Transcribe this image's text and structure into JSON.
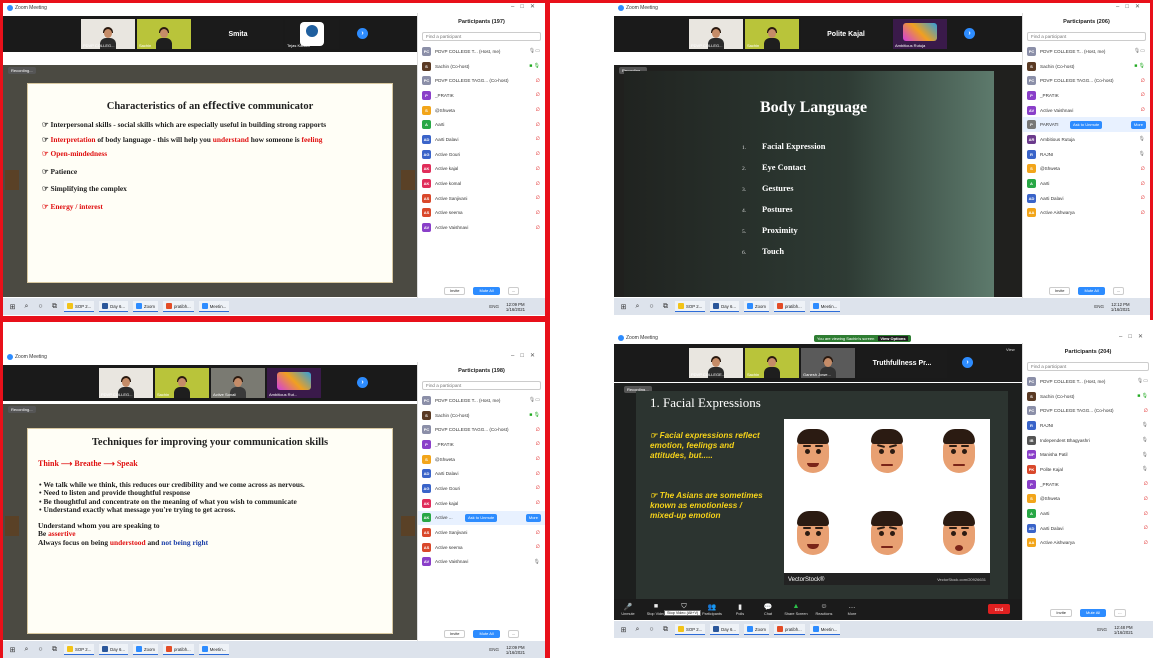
{
  "q1": {
    "window_title": "Zoom Meeting",
    "tiles": [
      "PDVP COLLEG...",
      "Sachin",
      "Smita",
      "Tejas Kadam"
    ],
    "recording": "Recording...",
    "slide_title_pre": "Characteristics of an ",
    "slide_title_emph": "effective",
    "slide_title_post": " communicator",
    "b1": "Interpersonal skills - social skills which are especially useful in building strong rapports",
    "b2_a": "Interpretation",
    "b2_b": " of body language - this will help you ",
    "b2_c": "understand",
    "b2_d": " how someone is ",
    "b2_e": "feeling",
    "b3": "Open-mindedness",
    "b4": "Patience",
    "b5": "Simplifying the complex",
    "b6": "Energy / interest",
    "participants_title": "Participants (197)",
    "find": "Find a participant",
    "rows": [
      {
        "init": "PC",
        "color": "#8b8fa8",
        "name": "PDVP COLLEGE T... (Host, me)"
      },
      {
        "init": "S",
        "color": "#5a3a24",
        "name": "Sachin (Co-host)"
      },
      {
        "init": "PC",
        "color": "#8b8fa8",
        "name": "PDVP COLLEGE TAGG... (Co-host)"
      },
      {
        "init": "P",
        "color": "#8a3fc9",
        "name": "_PRATIK"
      },
      {
        "init": "S",
        "color": "#f2a51a",
        "name": "@Shweta"
      },
      {
        "init": "A",
        "color": "#28a745",
        "name": "Aarti"
      },
      {
        "init": "AD",
        "color": "#3a64c9",
        "name": "Aarti Dalavi"
      },
      {
        "init": "AG",
        "color": "#3a64c9",
        "name": "Active Gouri"
      },
      {
        "init": "AK",
        "color": "#e02d5a",
        "name": "Active kajal"
      },
      {
        "init": "AK",
        "color": "#e02d5a",
        "name": "Active komal"
      },
      {
        "init": "AS",
        "color": "#d9482b",
        "name": "Active Sanjivani"
      },
      {
        "init": "AS",
        "color": "#d9482b",
        "name": "Active seema"
      },
      {
        "init": "AV",
        "color": "#8a3fc9",
        "name": "Active Vaishnavi"
      }
    ],
    "invite": "Invite",
    "mute_all": "Mute All",
    "more_btn": "...",
    "clock_time": "12:09 PM",
    "clock_date": "1/16/2021"
  },
  "q2": {
    "window_title": "Zoom Meeting",
    "tiles": [
      "PDVP COLLEG...",
      "Sachin",
      "Polite Kajal",
      "Ambitious Rutuja"
    ],
    "recording": "Recording...",
    "slide_title": "Body Language",
    "list": [
      {
        "n": "1.",
        "t": "Facial Expression"
      },
      {
        "n": "2.",
        "t": "Eye Contact"
      },
      {
        "n": "3.",
        "t": "Gestures"
      },
      {
        "n": "4.",
        "t": "Postures"
      },
      {
        "n": "5.",
        "t": "Proximity"
      },
      {
        "n": "6.",
        "t": "Touch"
      }
    ],
    "participants_title": "Participants (206)",
    "find": "Find a participant",
    "rows": [
      {
        "init": "PC",
        "color": "#8b8fa8",
        "name": "PDVP COLLEGE T... (Host, me)"
      },
      {
        "init": "S",
        "color": "#5a3a24",
        "name": "Sachin (Co-host)"
      },
      {
        "init": "PC",
        "color": "#8b8fa8",
        "name": "PDVP COLLEGE TAGG... (Co-host)"
      },
      {
        "init": "P",
        "color": "#8a3fc9",
        "name": "_PRATIK"
      },
      {
        "init": "AV",
        "color": "#8a3fc9",
        "name": "Active Vaishnavi"
      },
      {
        "init": "P",
        "color": "#777",
        "name": "PARVATI"
      },
      {
        "init": "AR",
        "color": "#6b3a8c",
        "name": "Ambitious Rutuja"
      },
      {
        "init": "R",
        "color": "#3a64c9",
        "name": "RAJNI"
      },
      {
        "init": "S",
        "color": "#f2a51a",
        "name": "@Shweta"
      },
      {
        "init": "A",
        "color": "#28a745",
        "name": "Aarti"
      },
      {
        "init": "AD",
        "color": "#3a64c9",
        "name": "Aarti Dalavi"
      },
      {
        "init": "AA",
        "color": "#f2a51a",
        "name": "Active Aishwarya"
      }
    ],
    "unmute": "Ask to Unmute",
    "more": "More",
    "invite": "Invite",
    "mute_all": "Mute All",
    "more_btn": "...",
    "clock_time": "12:12 PM",
    "clock_date": "1/16/2021"
  },
  "q3": {
    "window_title": "Zoom Meeting",
    "tiles": [
      "PDVP COLLEG...",
      "Sachin",
      "Active Sonali",
      "Ambitious Rut..."
    ],
    "recording": "Recording...",
    "slide_title": "Techniques for improving your communication skills",
    "think": "Think",
    "breathe": "Breathe",
    "speak": "Speak",
    "b1": "We talk while we think, this reduces our credibility and we come across as nervous.",
    "b2": "Need to listen and provide thoughtful response",
    "b3": "Be thoughtful and concentrate on the meaning of what you wish to communicate",
    "b4": "Understand exactly what message you're trying to get across.",
    "p1": "Understand whom you are speaking to",
    "p2_a": "Be ",
    "p2_b": "assertive",
    "p3_a": "Always focus on being ",
    "p3_b": "understood",
    "p3_c": " and ",
    "p3_d": "not being right",
    "participants_title": "Participants (198)",
    "find": "Find a participant",
    "rows": [
      {
        "init": "PC",
        "color": "#8b8fa8",
        "name": "PDVP COLLEGE T... (Host, me)"
      },
      {
        "init": "S",
        "color": "#5a3a24",
        "name": "Sachin (Co-host)"
      },
      {
        "init": "PC",
        "color": "#8b8fa8",
        "name": "PDVP COLLEGE TAGG... (Co-host)"
      },
      {
        "init": "P",
        "color": "#8a3fc9",
        "name": "_PRATIK"
      },
      {
        "init": "S",
        "color": "#f2a51a",
        "name": "@Shweta"
      },
      {
        "init": "AD",
        "color": "#3a64c9",
        "name": "Aarti Dalavi"
      },
      {
        "init": "AG",
        "color": "#3a64c9",
        "name": "Active Gouri"
      },
      {
        "init": "AK",
        "color": "#e02d5a",
        "name": "Active kajal"
      },
      {
        "init": "AK",
        "color": "#28a745",
        "name": "Active ..."
      },
      {
        "init": "AS",
        "color": "#d9482b",
        "name": "Active Sanjivani"
      },
      {
        "init": "AS",
        "color": "#d9482b",
        "name": "Active seema"
      },
      {
        "init": "AV",
        "color": "#8a3fc9",
        "name": "Active Vaishnavi"
      }
    ],
    "unmute": "Ask to Unmute",
    "more": "More",
    "invite": "Invite",
    "mute_all": "Mute All",
    "more_btn": "...",
    "clock_time": "12:09 PM",
    "clock_date": "1/16/2021"
  },
  "q4": {
    "window_title": "Zoom Meeting",
    "banner": "You are viewing Sachin's screen",
    "view_options": "View Options",
    "tiles": [
      "PDVP COLLEGE...",
      "Sachin",
      "Ganesh Jowe...",
      "Truthfullness Pr..."
    ],
    "view": "View",
    "recording": "Recording...",
    "slide_title": "1. Facial Expressions",
    "t1": "Facial expressions reflect emotion, feelings and attitudes, but.....",
    "t2": "The Asians are sometimes known as emotionless / mixed-up emotion",
    "watermark": "VectorStock®",
    "watermark_url": "VectorStock.com/20926631",
    "participants_title": "Participants (204)",
    "find": "Find a participant",
    "rows": [
      {
        "init": "PC",
        "color": "#8b8fa8",
        "name": "PDVP COLLEGE T... (Host, me)"
      },
      {
        "init": "S",
        "color": "#5a3a24",
        "name": "Sachin (Co-host)"
      },
      {
        "init": "PC",
        "color": "#8b8fa8",
        "name": "PDVP COLLEGE TAGG... (Co-host)"
      },
      {
        "init": "R",
        "color": "#3a64c9",
        "name": "RAJNI"
      },
      {
        "init": "IB",
        "color": "#555",
        "name": "Independent Bhagyashri"
      },
      {
        "init": "MP",
        "color": "#8a3fc9",
        "name": "Manisha Patil"
      },
      {
        "init": "PK",
        "color": "#d9482b",
        "name": "Polite Kajal"
      },
      {
        "init": "P",
        "color": "#8a3fc9",
        "name": "_PRATIK"
      },
      {
        "init": "S",
        "color": "#f2a51a",
        "name": "@Shweta"
      },
      {
        "init": "A",
        "color": "#28a745",
        "name": "Aarti"
      },
      {
        "init": "AD",
        "color": "#3a64c9",
        "name": "Aarti Dalavi"
      },
      {
        "init": "AA",
        "color": "#f2a51a",
        "name": "Active Aishwarya"
      }
    ],
    "tools": [
      "Unmute",
      "Stop Video",
      "Security",
      "Participants",
      "Polls",
      "Chat",
      "Share Screen",
      "Reactions",
      "More"
    ],
    "tooltip": "Stop Video (Alt+V)",
    "end": "End",
    "invite": "Invite",
    "mute_all": "Mute All",
    "more_btn": "...",
    "clock_time": "12:48 PM",
    "clock_date": "1/16/2021"
  },
  "taskbar": {
    "apps": [
      "SOP 2...",
      "Day 6...",
      "Zoom",
      "pratibh...",
      "Meetin..."
    ],
    "lang": "ENG"
  }
}
